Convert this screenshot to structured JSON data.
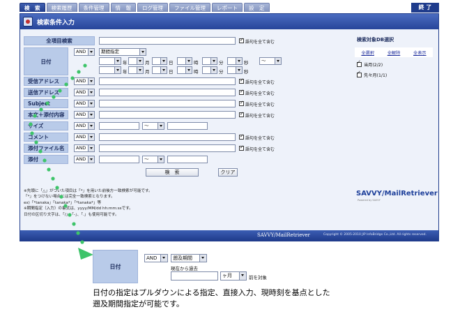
{
  "tabs": [
    {
      "label": "検　索",
      "active": true
    },
    {
      "label": "検索履歴",
      "active": false
    },
    {
      "label": "条件管理",
      "active": false
    },
    {
      "label": "情　報",
      "active": false
    },
    {
      "label": "ログ管理",
      "active": false
    },
    {
      "label": "ファイル管理",
      "active": false
    },
    {
      "label": "レポート",
      "active": false
    },
    {
      "label": "設　定",
      "active": false
    }
  ],
  "end_button": "終 了",
  "window_title": "検索条件入力",
  "include_synonyms_label": "語句を全て含む",
  "fields": {
    "all_items": "全項目検索",
    "date": "日付",
    "sender": "受信アドレス",
    "recipient": "送信アドレス",
    "subject": "Subject",
    "body": "本文＋添付内容",
    "size": "サイズ",
    "comment": "コメント",
    "attachment_name": "添付ファイル名",
    "attachment": "添付"
  },
  "selects": {
    "and": "AND",
    "date_mode": "期間指定",
    "tilde": "～"
  },
  "date_units": {
    "year": "年",
    "month": "月",
    "day": "日",
    "hour": "時",
    "minute": "分",
    "second": "秒"
  },
  "buttons": {
    "search": "検　索",
    "clear": "クリア"
  },
  "notes": [
    "※先頭に「△」がついた項目は「*」を用いた前後方一致検索が可能です。",
    "「*」をつけない場合には完全一致検索となります。",
    "ex)「*tanaka」「tanaka*」「*tanaka*」等",
    "※期間指定（入力）の書式は、yyyy/MM/dd hh:mm:ssです。",
    "日付の区切り文字は、「/」、「-」、「.」も使用可能です。"
  ],
  "right_panel": {
    "title": "検索対象DB選択",
    "links": [
      "全選択",
      "全解除",
      "全表示"
    ],
    "items": [
      {
        "label": "当月(2/2)",
        "checked": true
      },
      {
        "label": "先々月(1/1)",
        "checked": true
      }
    ]
  },
  "logo": "SAVVY/MailRetriever",
  "logo_sub": "Powered by SAVVY",
  "footer": {
    "brand": "SAVVY/MailRetriever",
    "copyright": "Copyright © 2005-2010 JIP InfoBridge Co.,Ltd. All rights reserved."
  },
  "zoom_panel": {
    "label": "日付",
    "and": "AND",
    "mode": "遡及期間",
    "hint": "現在から過去",
    "unit": "ヶ月",
    "suffix": "前を対象"
  },
  "caption": [
    "日付の指定はプルダウンによる指定、直接入力、現時刻を基点とした",
    "遡及期間指定が可能です。"
  ],
  "colors": {
    "accent": "#27459a",
    "label_bg": "#b9cbe9",
    "pointer": "#3ec46a"
  }
}
